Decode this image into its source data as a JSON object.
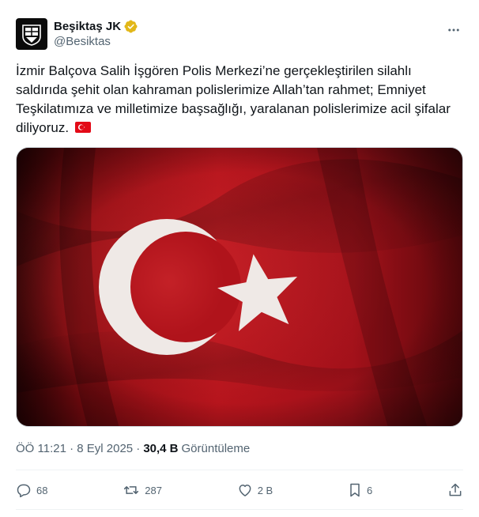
{
  "account": {
    "display_name": "Beşiktaş JK",
    "handle": "@Besiktas",
    "verified": true,
    "avatar_icon": "besiktas-crest-icon"
  },
  "tweet": {
    "text": "İzmir Balçova Salih İşgören Polis Merkezi’ne gerçekleştirilen silahlı saldırıda şehit olan kahraman polislerimize Allah’tan rahmet; Emniyet Teşkilatımıza ve milletimize başsağlığı, yaralanan polislerimize acil şifalar diliyoruz.",
    "emoji_icon": "turkish-flag-icon",
    "image_subject": "turkish-flag-image"
  },
  "meta": {
    "time_date": "ÖÖ 11:21 · 8 Eyl 2025 ·",
    "views_count": "30,4 B",
    "views_label": "Görüntüleme"
  },
  "actions": {
    "reply_count": "68",
    "repost_count": "287",
    "like_count": "2 B",
    "bookmark_count": "6"
  },
  "colors": {
    "text_primary": "#0f1419",
    "text_secondary": "#536471",
    "verified_gold": "#e2b719",
    "flag_red": "#b3121b",
    "border": "#eff3f4"
  }
}
